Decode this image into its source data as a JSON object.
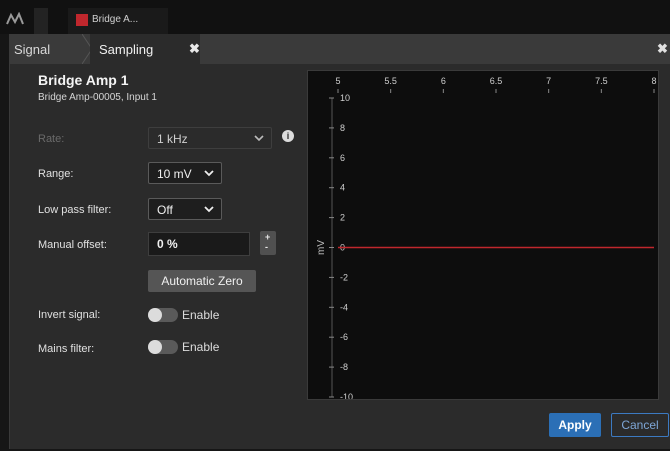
{
  "taskbar": {
    "tab_label": "Bridge A..."
  },
  "tabs": {
    "signal": "Signal",
    "sampling": "Sampling"
  },
  "device": {
    "title": "Bridge Amp 1",
    "subtitle": "Bridge Amp-00005, Input 1"
  },
  "form": {
    "rate_label": "Rate:",
    "rate_value": "1 kHz",
    "range_label": "Range:",
    "range_value": "10 mV",
    "lowpass_label": "Low pass filter:",
    "lowpass_value": "Off",
    "offset_label": "Manual offset:",
    "offset_value": "0 %",
    "auto_zero": "Automatic Zero",
    "invert_label": "Invert signal:",
    "invert_toggle": "Enable",
    "invert_enabled": false,
    "mains_label": "Mains filter:",
    "mains_toggle": "Enable",
    "mains_enabled": false
  },
  "buttons": {
    "apply": "Apply",
    "cancel": "Cancel"
  },
  "colors": {
    "accent": "#2b6fb6",
    "trace": "#c0272d"
  },
  "chart_data": {
    "type": "line",
    "x_ticks": [
      "5",
      "5.5",
      "6",
      "6.5",
      "7",
      "7.5",
      "8"
    ],
    "xlim": [
      5,
      8
    ],
    "y_ticks": [
      "10",
      "8",
      "6",
      "4",
      "2",
      "0",
      "-2",
      "-4",
      "-6",
      "-8",
      "-10"
    ],
    "ylim": [
      -10,
      10
    ],
    "ylabel": "mV",
    "series": [
      {
        "x": [
          5,
          8
        ],
        "y": [
          0,
          0
        ]
      }
    ]
  }
}
